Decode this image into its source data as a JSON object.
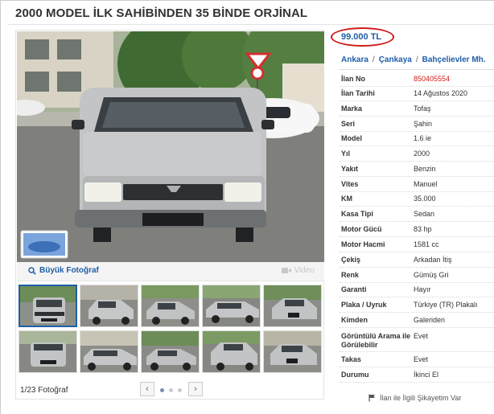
{
  "listing_title": "2000 MODEL İLK SAHİBİNDEN 35 BİNDE ORJİNAL",
  "price": "99.000 TL",
  "location": {
    "city": "Ankara",
    "district": "Çankaya",
    "neighborhood": "Bahçelievler Mh.",
    "separator": "/"
  },
  "details": [
    {
      "label": "İlan No",
      "value": "850405554"
    },
    {
      "label": "İlan Tarihi",
      "value": "14 Ağustos 2020"
    },
    {
      "label": "Marka",
      "value": "Tofaş"
    },
    {
      "label": "Seri",
      "value": "Şahin"
    },
    {
      "label": "Model",
      "value": "1.6 ie"
    },
    {
      "label": "Yıl",
      "value": "2000"
    },
    {
      "label": "Yakıt",
      "value": "Benzin"
    },
    {
      "label": "Vites",
      "value": "Manuel"
    },
    {
      "label": "KM",
      "value": "35.000"
    },
    {
      "label": "Kasa Tipi",
      "value": "Sedan"
    },
    {
      "label": "Motor Gücü",
      "value": "83 hp"
    },
    {
      "label": "Motor Hacmi",
      "value": "1581 cc"
    },
    {
      "label": "Çekiş",
      "value": "Arkadan İtiş"
    },
    {
      "label": "Renk",
      "value": "Gümüş Gri"
    },
    {
      "label": "Garanti",
      "value": "Hayır"
    },
    {
      "label": "Plaka / Uyruk",
      "value": "Türkiye (TR) Plakalı"
    },
    {
      "label": "Kimden",
      "value": "Galeriden"
    },
    {
      "label": "Görüntülü Arama ile Görülebilir",
      "value": "Evet"
    },
    {
      "label": "Takas",
      "value": "Evet"
    },
    {
      "label": "Durumu",
      "value": "İkinci El"
    }
  ],
  "photo_toolbar": {
    "big_photo": "Büyük Fotoğraf",
    "video": "Video"
  },
  "photo_footer": {
    "count": "1/23 Fotoğraf",
    "prev": "‹",
    "next": "›"
  },
  "report_link": "İlan ile İlgili Şikayetim Var",
  "colors": {
    "link_blue": "#1f5ea8",
    "listing_no_red": "#d01c1c",
    "price_circle_red": "#d01c1c",
    "car_silver": "#bfc0c2"
  }
}
